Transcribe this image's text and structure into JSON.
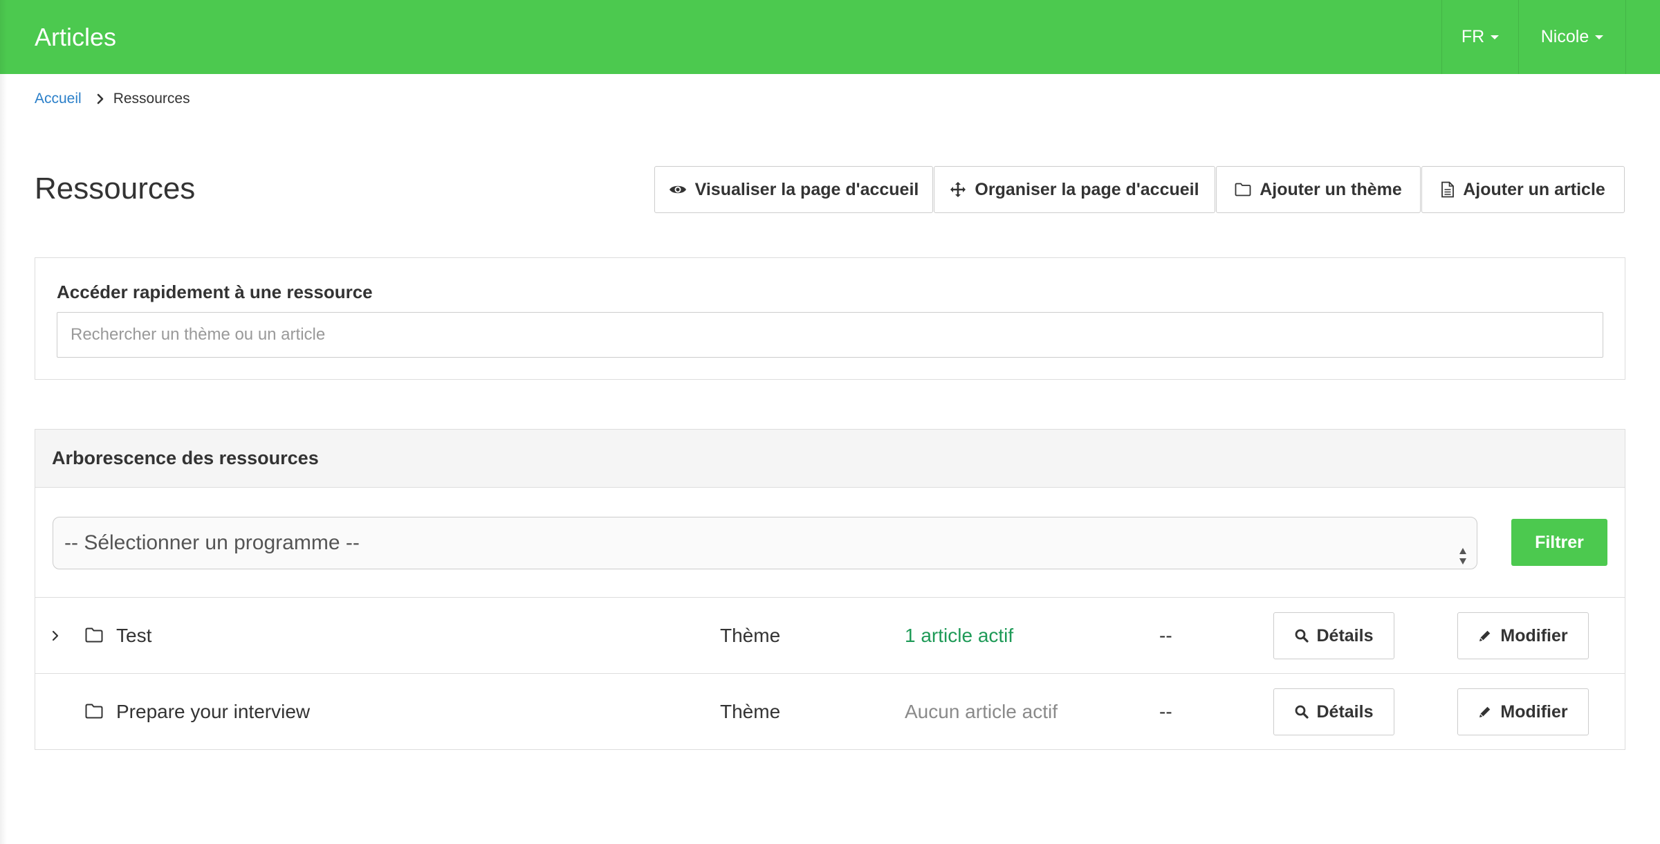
{
  "navbar": {
    "title": "Articles",
    "language": "FR",
    "user": "Nicole",
    "color": "#4cc94f"
  },
  "breadcrumb": {
    "home": "Accueil",
    "current": "Ressources"
  },
  "page": {
    "title": "Ressources"
  },
  "actions": {
    "view_home": {
      "label": "Visualiser la page d'accueil",
      "icon": "eye-icon"
    },
    "organize_home": {
      "label": "Organiser la page d'accueil",
      "icon": "move-icon"
    },
    "add_theme": {
      "label": "Ajouter un thème",
      "icon": "folder-icon"
    },
    "add_article": {
      "label": "Ajouter un article",
      "icon": "document-icon"
    }
  },
  "quick_access": {
    "label": "Accéder rapidement à une ressource",
    "placeholder": "Rechercher un thème ou un article",
    "value": ""
  },
  "tree": {
    "title": "Arborescence des ressources",
    "program_select": {
      "selected": "-- Sélectionner un programme --"
    },
    "filter_label": "Filtrer",
    "rows": [
      {
        "name": "Test",
        "type": "Thème",
        "status": "1 article actif",
        "status_color": "#1e9a57",
        "extra": "--",
        "details_label": "Détails",
        "edit_label": "Modifier",
        "expandable": true
      },
      {
        "name": "Prepare your interview",
        "type": "Thème",
        "status": "Aucun article actif",
        "status_color": "#8a8a8a",
        "extra": "--",
        "details_label": "Détails",
        "edit_label": "Modifier",
        "expandable": false
      }
    ]
  }
}
